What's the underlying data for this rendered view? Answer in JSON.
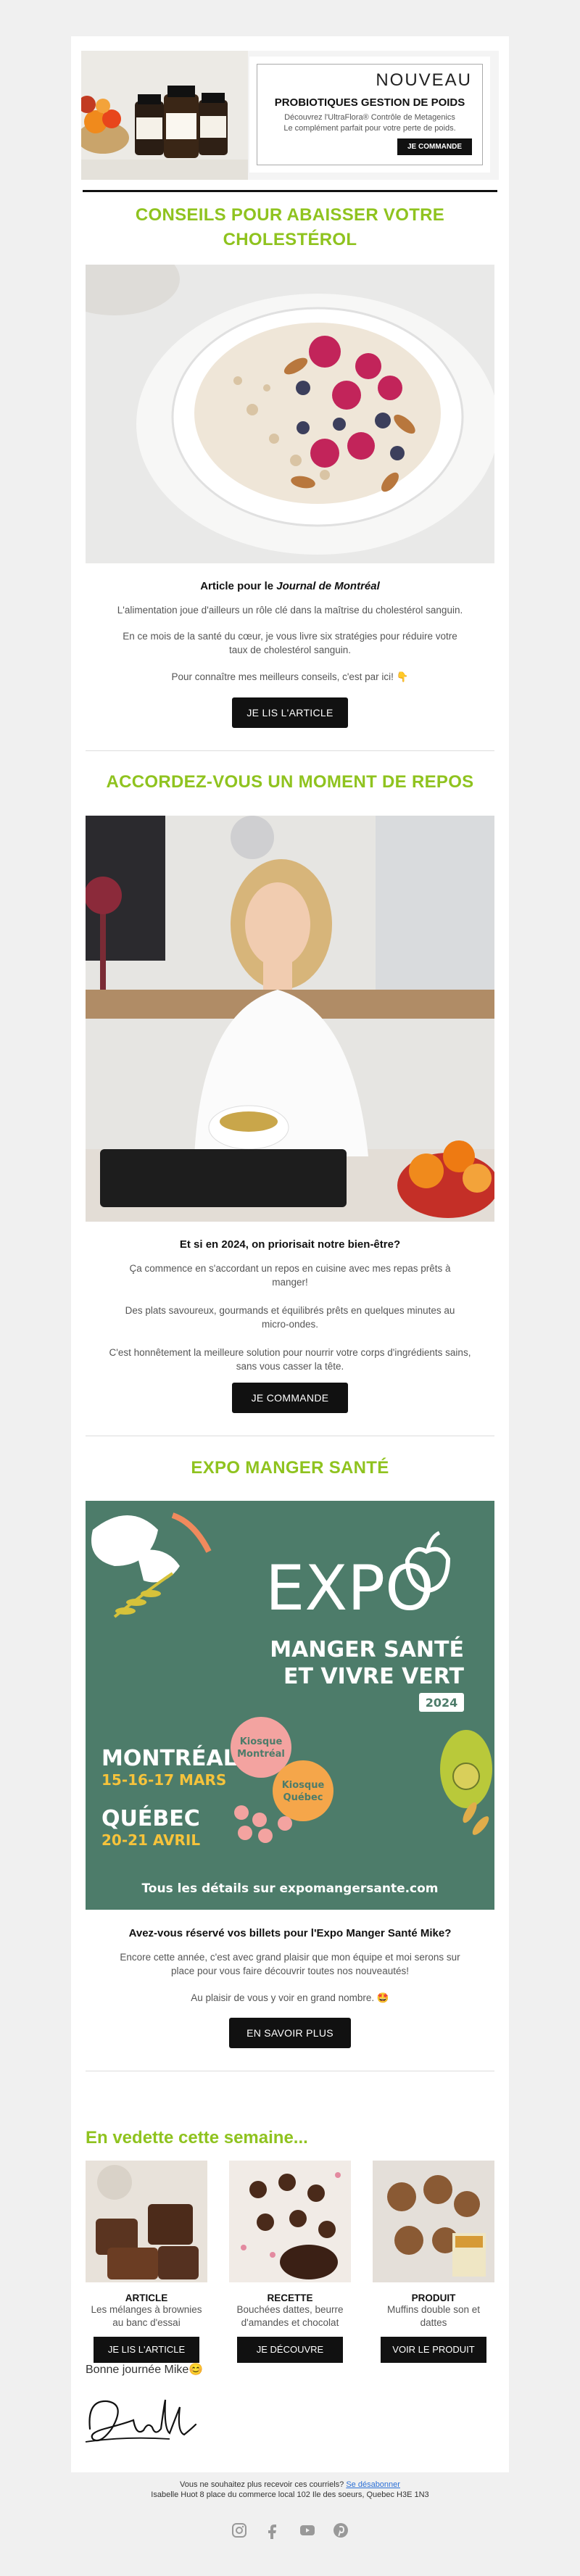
{
  "promo": {
    "nouveau": "NOUVEAU",
    "title": "PROBIOTIQUES GESTION DE POIDS",
    "desc_line1": "Découvrez l'UltraFlora® Contrôle de Metagenics",
    "desc_line2": "Le complément parfait pour votre perte de poids.",
    "button": "JE COMMANDE"
  },
  "section1": {
    "title_line1": "CONSEILS POUR ABAISSER VOTRE",
    "title_line2": "CHOLESTÉROL",
    "subtitle_prefix": "Article pour le ",
    "subtitle_em": "Journal de Montréal",
    "p1": "L'alimentation joue d'ailleurs un rôle clé dans la maîtrise du cholestérol sanguin.",
    "p2": "En ce mois de la santé du cœur, je vous livre six stratégies pour réduire votre taux de cholestérol sanguin.",
    "p3": "Pour connaître mes meilleurs conseils, c'est par ici! 👇",
    "button": "JE LIS L'ARTICLE"
  },
  "section2": {
    "title": "ACCORDEZ-VOUS UN MOMENT DE REPOS",
    "subtitle": "Et si en 2024, on priorisait notre bien-être?",
    "p1": "Ça commence en s'accordant un repos en cuisine avec mes repas prêts à manger!",
    "p2": "Des plats savoureux, gourmands et équilibrés prêts en quelques minutes au micro-ondes.",
    "p3": "C'est honnêtement la meilleure solution pour nourrir votre corps d'ingrédients sains, sans vous casser la tête.",
    "button": "JE COMMANDE"
  },
  "section3": {
    "title": "EXPO MANGER SANTÉ",
    "poster": {
      "expo": "EXPO",
      "line1": "MANGER SANTÉ",
      "line2": "ET VIVRE VERT",
      "year": "2024",
      "city1": "MONTRÉAL",
      "date1": "15-16-17 MARS",
      "city2": "QUÉBEC",
      "date2": "20-21 AVRIL",
      "kiosque1_a": "Kiosque",
      "kiosque1_b": "Montréal",
      "kiosque2_a": "Kiosque",
      "kiosque2_b": "Québec",
      "footer": "Tous les détails sur expomangersante.com"
    },
    "subtitle": "Avez-vous réservé vos billets pour l'Expo Manger Santé Mike?",
    "p1": "Encore cette année, c'est avec grand plaisir que mon équipe et moi serons sur place pour vous faire découvrir toutes nos nouveautés!",
    "p2": "Au plaisir de vous y voir en grand nombre. 🤩",
    "button": "EN SAVOIR PLUS"
  },
  "vedette": {
    "title": "En vedette cette semaine...",
    "items": [
      {
        "kind": "ARTICLE",
        "desc": "Les mélanges à brownies au banc d'essai",
        "button": "JE LIS L'ARTICLE"
      },
      {
        "kind": "RECETTE",
        "desc": "Bouchées dattes, beurre d'amandes et chocolat",
        "button": "JE DÉCOUVRE"
      },
      {
        "kind": "PRODUIT",
        "desc": "Muffins double son et dattes",
        "button": "VOIR LE PRODUIT"
      }
    ]
  },
  "closing": {
    "greeting": "Bonne journée Mike😊",
    "signature": "Isabelle"
  },
  "footer": {
    "line1_prefix": "Vous ne souhaitez plus recevoir ces courriels? ",
    "unsubscribe": "Se désabonner",
    "line2": "Isabelle Huot 8 place du commerce local 102 Ile des soeurs, Quebec H3E 1N3"
  },
  "colors": {
    "accent": "#8fc31f",
    "button": "#111111",
    "poster_bg": "#4d7c6a"
  }
}
